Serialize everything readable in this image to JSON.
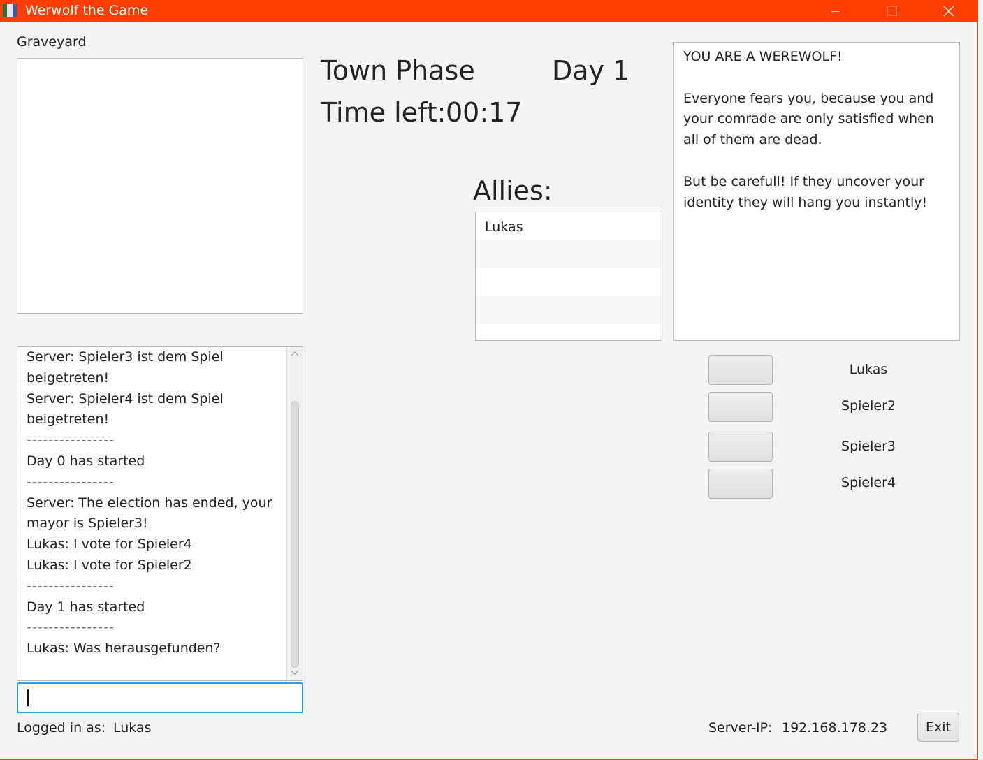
{
  "window": {
    "title": "Werwolf the Game"
  },
  "graveyard": {
    "label": "Graveyard"
  },
  "phase": {
    "name": "Town Phase",
    "day": "Day 1",
    "time_label": "Time left:",
    "time_value": "00:17"
  },
  "allies": {
    "label": "Allies:",
    "rows": [
      "Lukas",
      "",
      "",
      ""
    ]
  },
  "role": {
    "paragraphs": [
      "YOU ARE A WEREWOLF!",
      "Everyone fears you, because you and your comrade are only satisfied when all of them are dead.",
      "But be carefull! If they uncover your identity they will hang you instantly!"
    ]
  },
  "chat": {
    "lines": [
      "Server: Spieler3 ist dem Spiel",
      "beigetreten!",
      "Server: Spieler4 ist dem Spiel",
      "beigetreten!",
      "----------------",
      "Day 0 has started",
      "----------------",
      "Server: The election has ended, your",
      "mayor is Spieler3!",
      "Lukas: I vote for Spieler4",
      "Lukas: I vote for Spieler2",
      "----------------",
      "Day 1 has started",
      "----------------",
      "Lukas: Was herausgefunden?"
    ],
    "input_value": ""
  },
  "players": [
    {
      "name": "Lukas"
    },
    {
      "name": "Spieler2"
    },
    {
      "name": "Spieler3"
    },
    {
      "name": "Spieler4"
    }
  ],
  "footer": {
    "logged_in_label": "Logged in as:",
    "logged_in_user": "Lukas",
    "server_ip_label": "Server-IP:",
    "server_ip": "192.168.178.23",
    "exit_label": "Exit"
  },
  "colors": {
    "titlebar": "#ff3d00",
    "focus": "#2a9fd6"
  },
  "icons": {
    "app": "app-icon",
    "minimize": "minimize-icon",
    "maximize": "maximize-icon",
    "close": "close-icon"
  }
}
